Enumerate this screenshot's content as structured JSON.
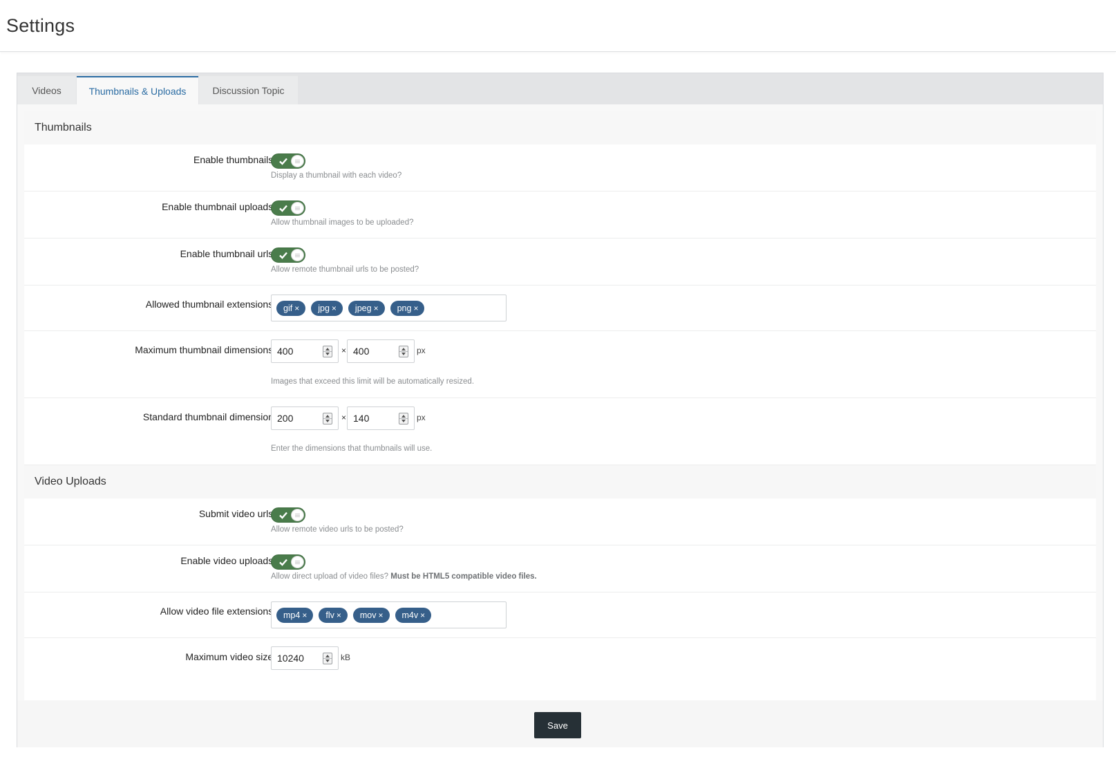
{
  "page": {
    "title": "Settings"
  },
  "tabs": [
    {
      "label": "Videos",
      "active": false
    },
    {
      "label": "Thumbnails & Uploads",
      "active": true
    },
    {
      "label": "Discussion Topic",
      "active": false
    }
  ],
  "sections": {
    "thumbnails": {
      "title": "Thumbnails",
      "enable_thumbnails": {
        "label": "Enable thumbnails?",
        "help": "Display a thumbnail with each video?",
        "on": true
      },
      "enable_thumbnail_uploads": {
        "label": "Enable thumbnail uploads?",
        "help": "Allow thumbnail images to be uploaded?",
        "on": true
      },
      "enable_thumbnail_urls": {
        "label": "Enable thumbnail urls?",
        "help": "Allow remote thumbnail urls to be posted?",
        "on": true
      },
      "allowed_extensions": {
        "label": "Allowed thumbnail extensions?",
        "tags": [
          "gif",
          "jpg",
          "jpeg",
          "png"
        ]
      },
      "max_dimensions": {
        "label": "Maximum thumbnail dimensions?",
        "width": "400",
        "height": "400",
        "times": "×",
        "unit": "px",
        "help": "Images that exceed this limit will be automatically resized."
      },
      "standard_dimensions": {
        "label": "Standard thumbnail dimensions",
        "width": "200",
        "height": "140",
        "times": "×",
        "unit": "px",
        "help": "Enter the dimensions that thumbnails will use."
      }
    },
    "video_uploads": {
      "title": "Video Uploads",
      "submit_video_urls": {
        "label": "Submit video urls?",
        "help": "Allow remote video urls to be posted?",
        "on": true
      },
      "enable_video_uploads": {
        "label": "Enable video uploads?",
        "help_plain": "Allow direct upload of video files?",
        "help_bold": "Must be HTML5 compatible video files.",
        "on": true
      },
      "allowed_extensions": {
        "label": "Allow video file extensions?",
        "tags": [
          "mp4",
          "flv",
          "mov",
          "m4v"
        ]
      },
      "max_size": {
        "label": "Maximum video size?",
        "value": "10240",
        "unit": "kB"
      }
    }
  },
  "tag_remove_glyph": "×",
  "footer": {
    "save_label": "Save"
  },
  "colors": {
    "accent": "#2b6ca3",
    "toggle_on": "#4a7c4b",
    "tag_bg": "#365f8a",
    "save_bg": "#263036"
  },
  "icons": {
    "toggle_check": "check-icon",
    "spinner": "spinner-arrows-icon",
    "tag_remove": "close-icon"
  }
}
